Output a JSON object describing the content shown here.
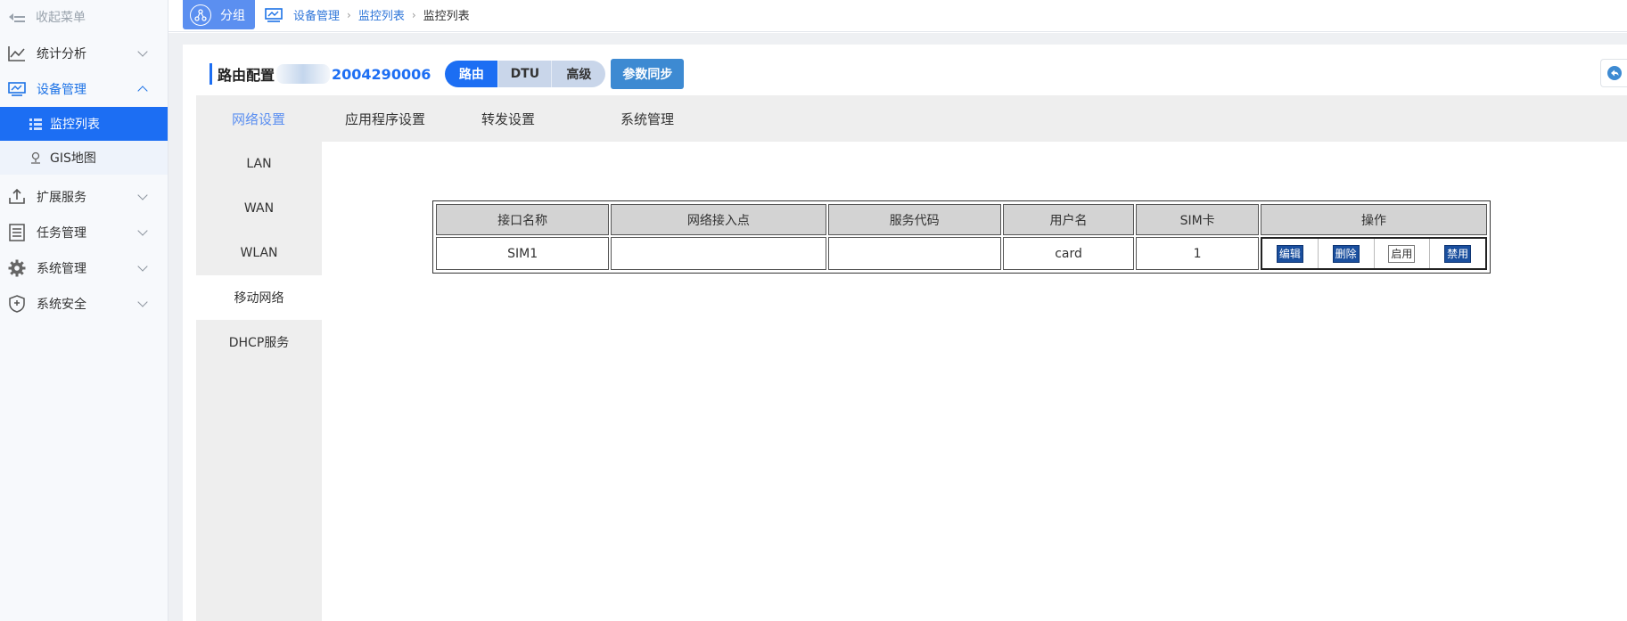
{
  "sidebar": {
    "collapse_label": "收起菜单",
    "items": [
      {
        "label": "统计分析"
      },
      {
        "label": "设备管理"
      },
      {
        "label": "扩展服务"
      },
      {
        "label": "任务管理"
      },
      {
        "label": "系统管理"
      },
      {
        "label": "系统安全"
      }
    ],
    "sub_items": [
      {
        "label": "监控列表"
      },
      {
        "label": "GIS地图"
      }
    ]
  },
  "topbar": {
    "group_label": "分组",
    "breadcrumb": [
      "设备管理",
      "监控列表",
      "监控列表"
    ]
  },
  "header": {
    "title": "路由配置",
    "device_code": "2004290006",
    "mode_tabs": [
      "路由",
      "DTU",
      "高级"
    ],
    "active_mode": "路由",
    "sync_label": "参数同步"
  },
  "tabs": [
    "网络设置",
    "应用程序设置",
    "转发设置",
    "系统管理"
  ],
  "active_tab": "网络设置",
  "side_nav": [
    "LAN",
    "WAN",
    "WLAN",
    "移动网络",
    "DHCP服务"
  ],
  "active_side_nav": "移动网络",
  "table": {
    "columns": [
      "接口名称",
      "网络接入点",
      "服务代码",
      "用户名",
      "SIM卡",
      "操作"
    ],
    "rows": [
      {
        "cells": [
          "SIM1",
          "",
          "",
          "card",
          "1"
        ],
        "actions": [
          "编辑",
          "删除",
          "启用",
          "禁用"
        ]
      }
    ]
  },
  "colors": {
    "accent": "#1c6ef3",
    "sidebar_selected": "#1c6ef3",
    "tab_active": "#5b8ff0",
    "action_button": "#1a4f9e"
  }
}
